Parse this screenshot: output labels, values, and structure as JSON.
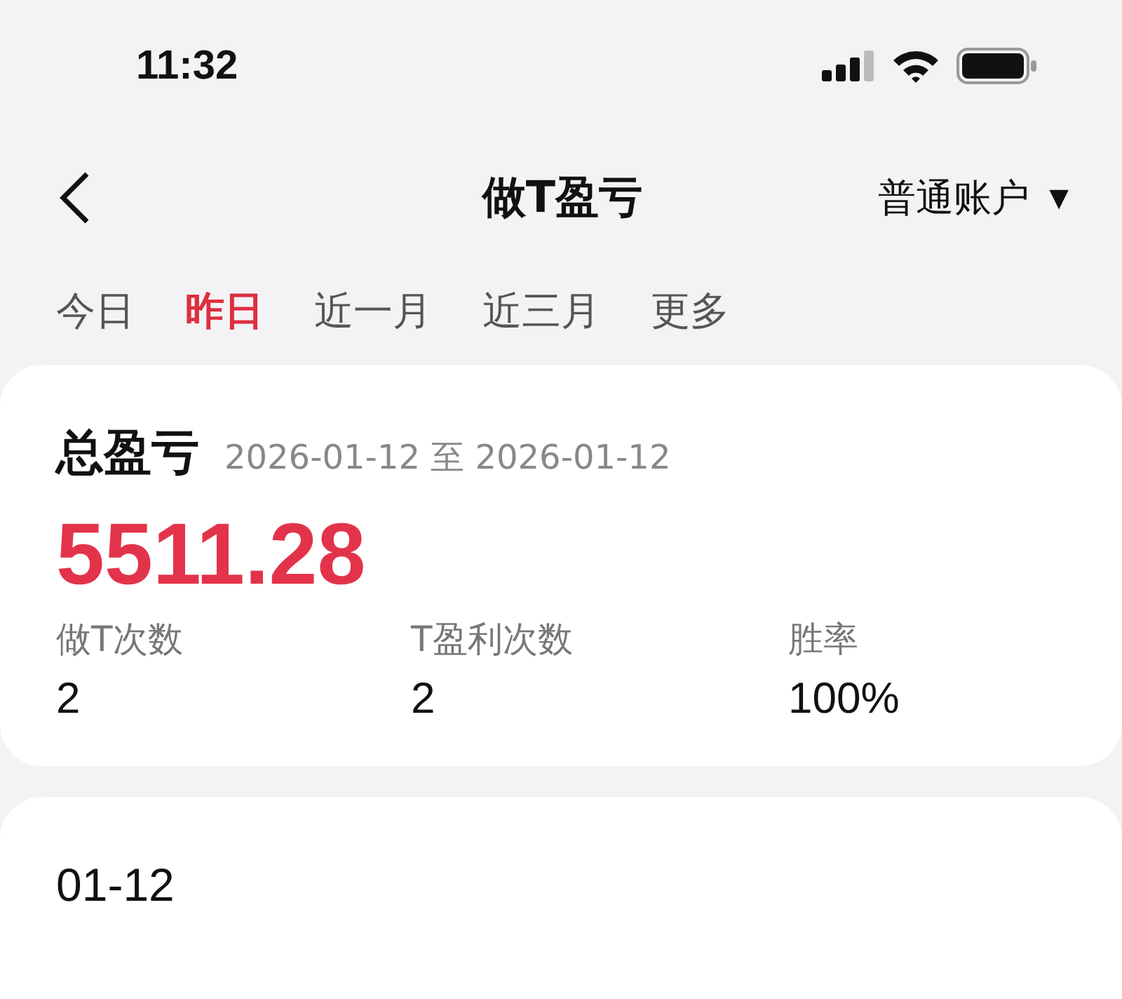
{
  "status_bar": {
    "time": "11:32"
  },
  "nav": {
    "title": "做T盈亏",
    "account": "普通账户",
    "dropdown_glyph": "▼"
  },
  "tabs": [
    {
      "label": "今日",
      "selected": false
    },
    {
      "label": "昨日",
      "selected": true
    },
    {
      "label": "近一月",
      "selected": false
    },
    {
      "label": "近三月",
      "selected": false
    },
    {
      "label": "更多",
      "selected": false
    }
  ],
  "summary": {
    "title": "总盈亏",
    "date_range": "2026-01-12 至 2026-01-12",
    "total": "5511.28",
    "stats": [
      {
        "label": "做T次数",
        "value": "2"
      },
      {
        "label": "T盈利次数",
        "value": "2"
      },
      {
        "label": "胜率",
        "value": "100%"
      }
    ]
  },
  "day_card": {
    "date": "01-12"
  }
}
